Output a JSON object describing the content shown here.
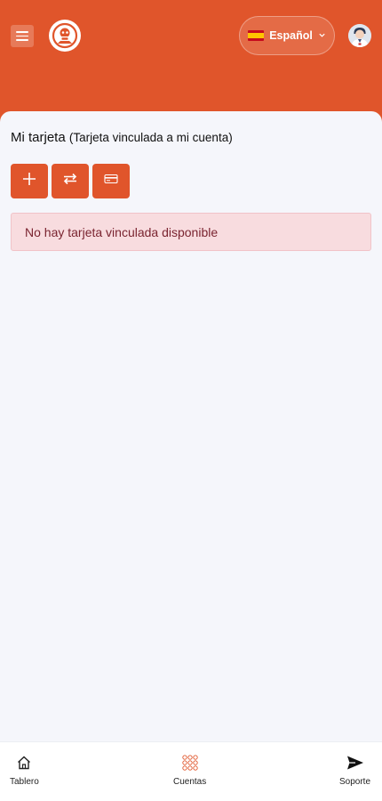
{
  "colors": {
    "accent": "#e0552b",
    "page_bg": "#f5f6fb",
    "alert_bg": "#f8dcdf",
    "alert_text": "#7a2430"
  },
  "header": {
    "menu_icon": "hamburger-menu-icon",
    "logo_icon": "brand-logo-icon",
    "language": {
      "label": "Español",
      "flag_icon": "spain-flag-icon",
      "chevron_icon": "chevron-down-icon"
    },
    "avatar_icon": "user-avatar-icon"
  },
  "main": {
    "title": "Mi tarjeta",
    "subtitle": "(Tarjeta vinculada a mi cuenta)",
    "actions": [
      {
        "icon": "plus-icon"
      },
      {
        "icon": "transfer-arrows-icon"
      },
      {
        "icon": "credit-card-icon"
      }
    ],
    "alert": "No hay tarjeta vinculada disponible"
  },
  "bottom_nav": [
    {
      "label": "Tablero",
      "icon": "home-icon"
    },
    {
      "label": "Cuentas",
      "icon": "grid-dots-icon"
    },
    {
      "label": "Soporte",
      "icon": "send-icon"
    }
  ]
}
